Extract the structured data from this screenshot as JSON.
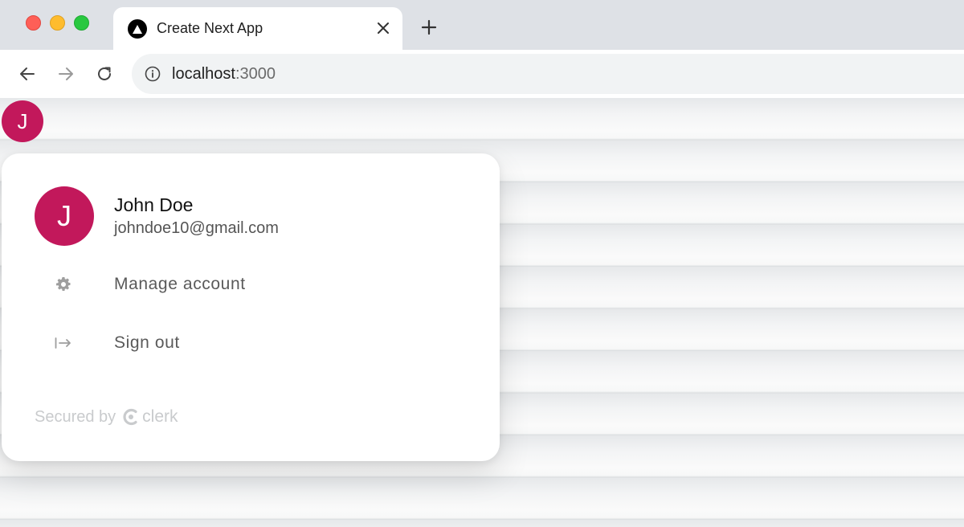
{
  "browser": {
    "tab": {
      "title": "Create Next App",
      "favicon": "nextjs-triangle-icon"
    },
    "new_tab_icon": "plus-icon",
    "url": {
      "host": "localhost",
      "port": ":3000"
    },
    "nav_icons": [
      "arrow-left-icon",
      "arrow-right-icon",
      "reload-icon",
      "info-icon"
    ]
  },
  "user_button": {
    "initial": "J",
    "color": "#c2185b"
  },
  "popover": {
    "avatar_initial": "J",
    "name": "John Doe",
    "email": "johndoe10@gmail.com",
    "menu": [
      {
        "label": "Manage account",
        "icon": "gear-icon"
      },
      {
        "label": "Sign out",
        "icon": "sign-out-icon"
      }
    ],
    "footer": {
      "secured_by": "Secured by",
      "brand": "clerk"
    }
  }
}
